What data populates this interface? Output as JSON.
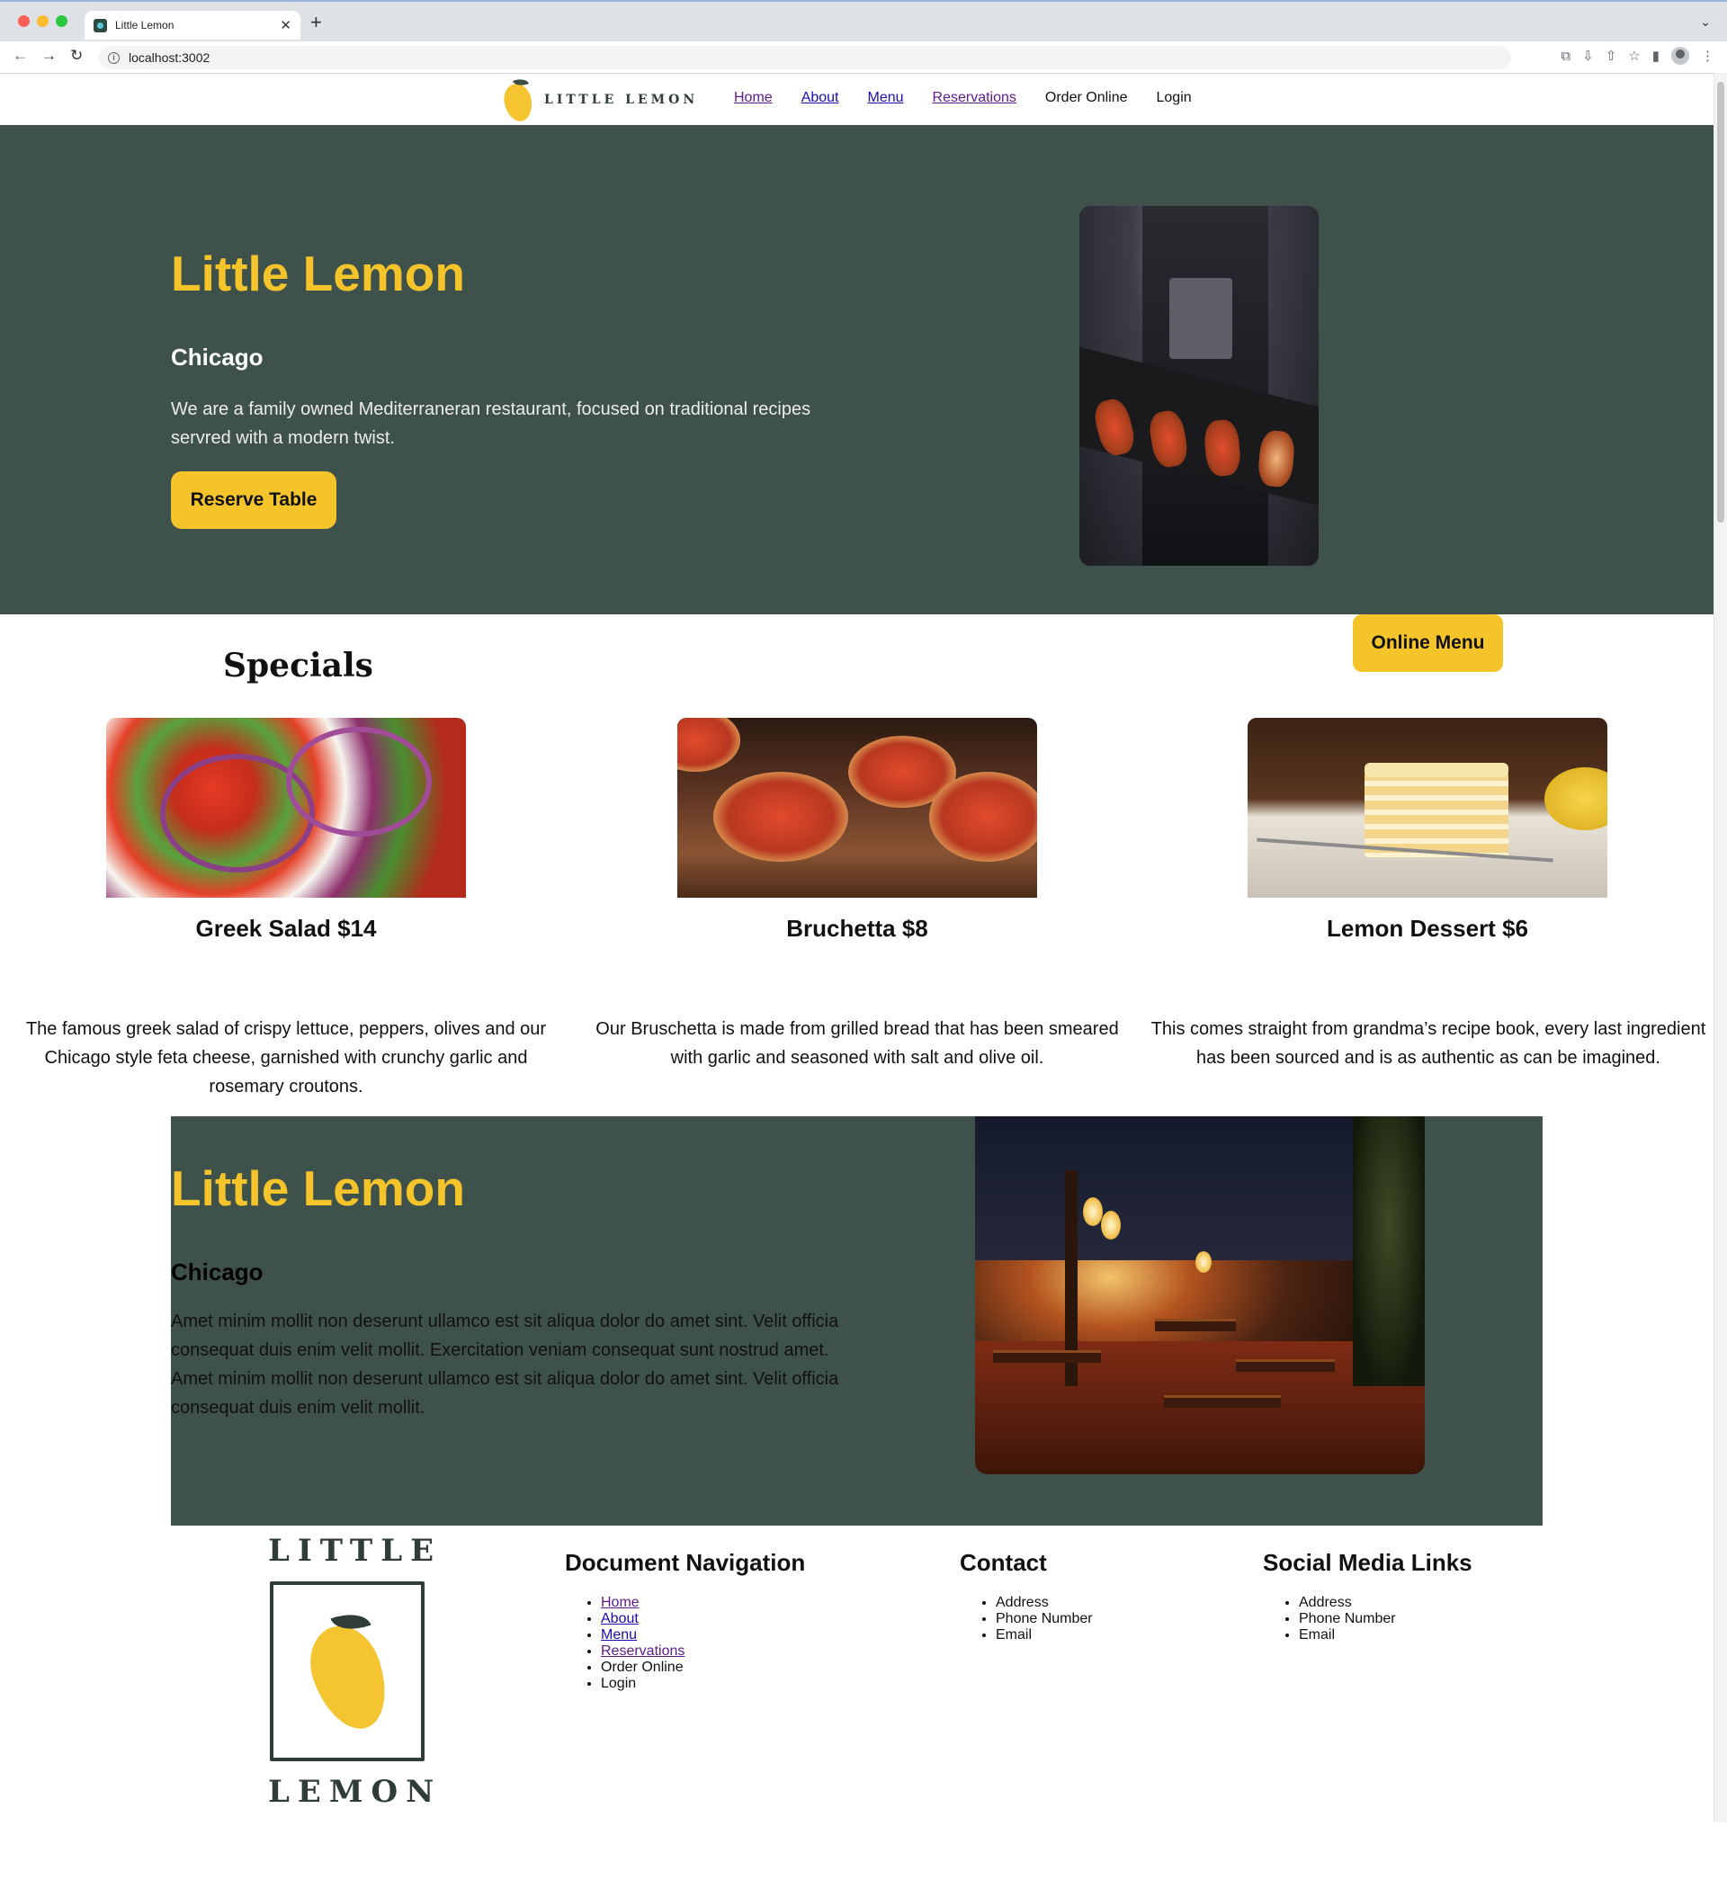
{
  "browser": {
    "tab_title": "Little Lemon",
    "url": "localhost:3002"
  },
  "site": {
    "logo_text": "LITTLE LEMON",
    "nav": [
      {
        "label": "Home"
      },
      {
        "label": "About"
      },
      {
        "label": "Menu"
      },
      {
        "label": "Reservations"
      },
      {
        "label": "Order Online"
      },
      {
        "label": "Login"
      }
    ]
  },
  "hero": {
    "title": "Little Lemon",
    "city": "Chicago",
    "description": "We are a family owned Mediterraneran restaurant, focused on traditional recipes servred with a modern twist.",
    "cta": "Reserve Table"
  },
  "specials": {
    "heading": "Specials",
    "online_menu": "Online Menu",
    "cards": [
      {
        "title": "Greek Salad $14",
        "description": "The famous greek salad of crispy lettuce, peppers, olives and our Chicago style feta cheese, garnished with crunchy garlic and rosemary croutons."
      },
      {
        "title": "Bruchetta $8",
        "description": "Our Bruschetta is made from grilled bread that has been smeared with garlic and seasoned with salt and olive oil."
      },
      {
        "title": "Lemon Dessert $6",
        "description": "This comes straight from grandma’s recipe book, every last ingredient has been sourced and is as authentic as can be imagined."
      }
    ]
  },
  "about": {
    "title": "Little Lemon",
    "city": "Chicago",
    "description": "Amet minim mollit non deserunt ullamco est sit aliqua dolor do amet sint. Velit officia consequat duis enim velit mollit. Exercitation veniam consequat sunt nostrud amet. Amet minim mollit non deserunt ullamco est sit aliqua dolor do amet sint. Velit officia consequat duis enim velit mollit."
  },
  "footer": {
    "logo_top": "LITTLE",
    "logo_bottom": "LEMON",
    "doc_nav": {
      "heading": "Document Navigation",
      "items": [
        "Home",
        "About",
        "Menu",
        "Reservations",
        "Order Online",
        "Login"
      ]
    },
    "contact": {
      "heading": "Contact",
      "items": [
        "Address",
        "Phone Number",
        "Email"
      ]
    },
    "social": {
      "heading": "Social Media Links",
      "items": [
        "Address",
        "Phone Number",
        "Email"
      ]
    }
  },
  "colors": {
    "brand_green": "#3e514b",
    "brand_yellow": "#f4c42a"
  }
}
